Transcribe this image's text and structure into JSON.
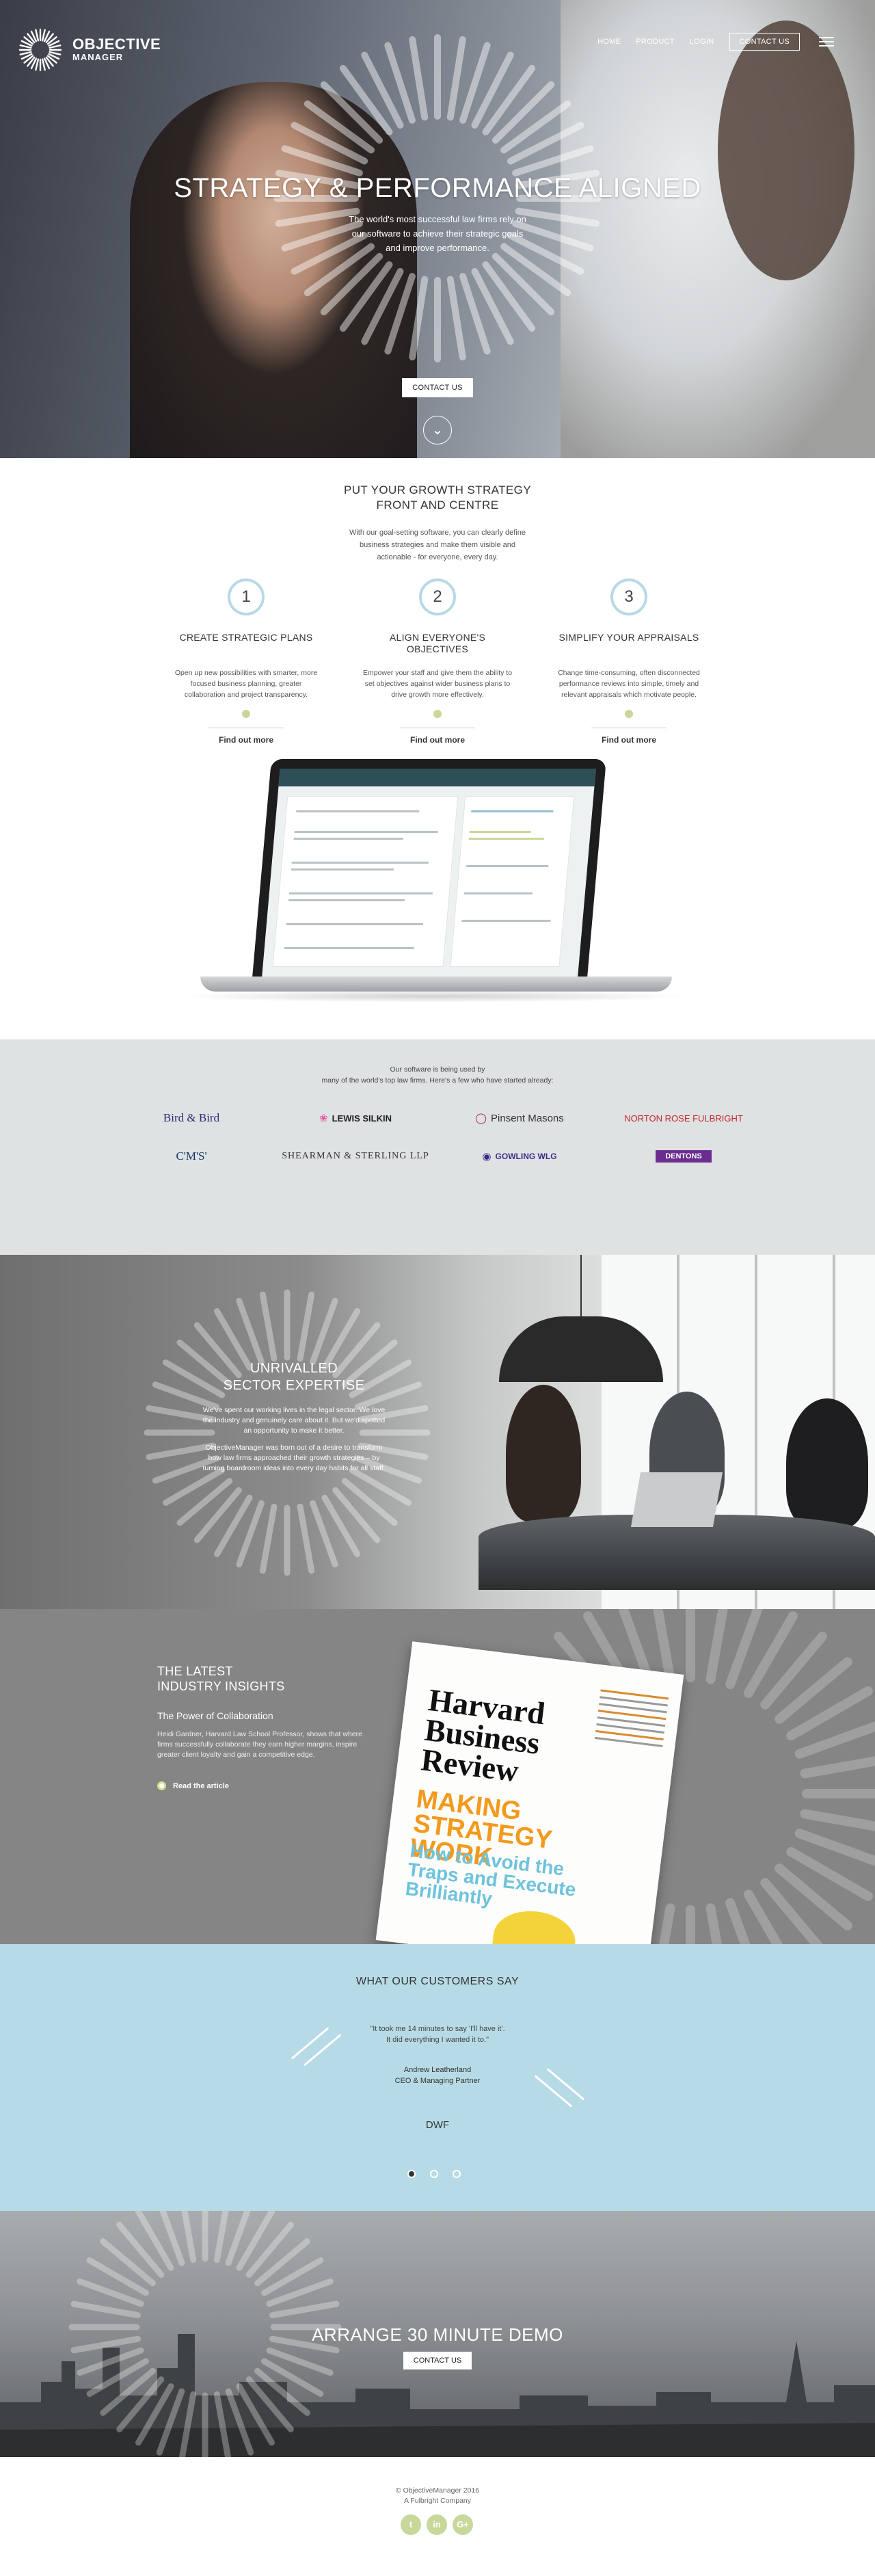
{
  "nav": {
    "logo_line1": "OBJECTIVE",
    "logo_line2": "MANAGER",
    "home": "HOME",
    "product": "PRODUCT",
    "login": "LOGIN",
    "contact": "CONTACT US"
  },
  "hero": {
    "title": "STRATEGY & PERFORMANCE ALIGNED",
    "subtitle": "The world's most successful law firms rely on our software to achieve their strategic goals and improve performance.",
    "button": "CONTACT US"
  },
  "growth": {
    "title_line1": "PUT YOUR GROWTH STRATEGY",
    "title_line2": "FRONT AND CENTRE",
    "intro": "With our goal-setting software, you can clearly define business strategies and make them visible and actionable - for everyone, every day.",
    "steps": [
      {
        "num": "1",
        "title": "CREATE STRATEGIC PLANS",
        "text": "Open up new possibilities with smarter, more focused business planning, greater collaboration and project transparency.",
        "link": "Find out more"
      },
      {
        "num": "2",
        "title": "ALIGN EVERYONE'S OBJECTIVES",
        "text": "Empower your staff and give them the ability to set objectives against wider business plans to drive growth more effectively.",
        "link": "Find out more"
      },
      {
        "num": "3",
        "title": "SIMPLIFY YOUR APPRAISALS",
        "text": "Change time-consuming, often disconnected performance reviews into simple, timely and relevant appraisals which motivate people.",
        "link": "Find out more"
      }
    ]
  },
  "clients": {
    "intro_line1": "Our software is being used by",
    "intro_line2": "many of the world's top law firms. Here's a few who have started already:",
    "logos": [
      "Bird & Bird",
      "LEWIS SILKIN",
      "Pinsent Masons",
      "NORTON ROSE FULBRIGHT",
      "C'M'S'",
      "SHEARMAN & STERLING LLP",
      "GOWLING WLG",
      "DENTONS"
    ]
  },
  "sector": {
    "title_line1": "UNRIVALLED",
    "title_line2": "SECTOR EXPERTISE",
    "p1": "We've spent our working lives in the legal sector. We love the industry and genuinely care about it. But we'd spotted an opportunity to make it better.",
    "p2": "ObjectiveManager was born out of a desire to transform how law firms approached their growth strategies – by turning boardroom ideas into every day habits for all staff."
  },
  "insights": {
    "title_line1": "THE LATEST",
    "title_line2": "INDUSTRY INSIGHTS",
    "subtitle": "The Power of Collaboration",
    "text": "Heidi Gardner, Harvard Law School Professor, shows that where firms successfully collaborate they earn higher margins, inspire greater client loyalty and gain a competitive edge.",
    "link": "Read the article",
    "mag_title": "Harvard Business Review",
    "mag_headline": "MAKING STRATEGY WORK",
    "mag_sub": "How to Avoid the Traps and Execute Brilliantly"
  },
  "testimonials": {
    "title": "WHAT OUR CUSTOMERS SAY",
    "quote_line1": "\"It took me 14 minutes to say 'I'll have it'.",
    "quote_line2": "It did everything I wanted it to.\"",
    "name": "Andrew Leatherland",
    "role": "CEO & Managing Partner",
    "company": "DWF"
  },
  "demo": {
    "title": "ARRANGE 30 MINUTE DEMO",
    "button": "CONTACT US"
  },
  "footer": {
    "copyright": "© ObjectiveManager 2016",
    "company": "A Fulbright Company",
    "social": [
      "t",
      "in",
      "G+"
    ]
  },
  "colors": {
    "accent_green": "#c8d89a",
    "step_ring": "#b7d9e6",
    "testimonial_bg": "#b7dbe6",
    "client_bg": "#dfe2e3"
  }
}
